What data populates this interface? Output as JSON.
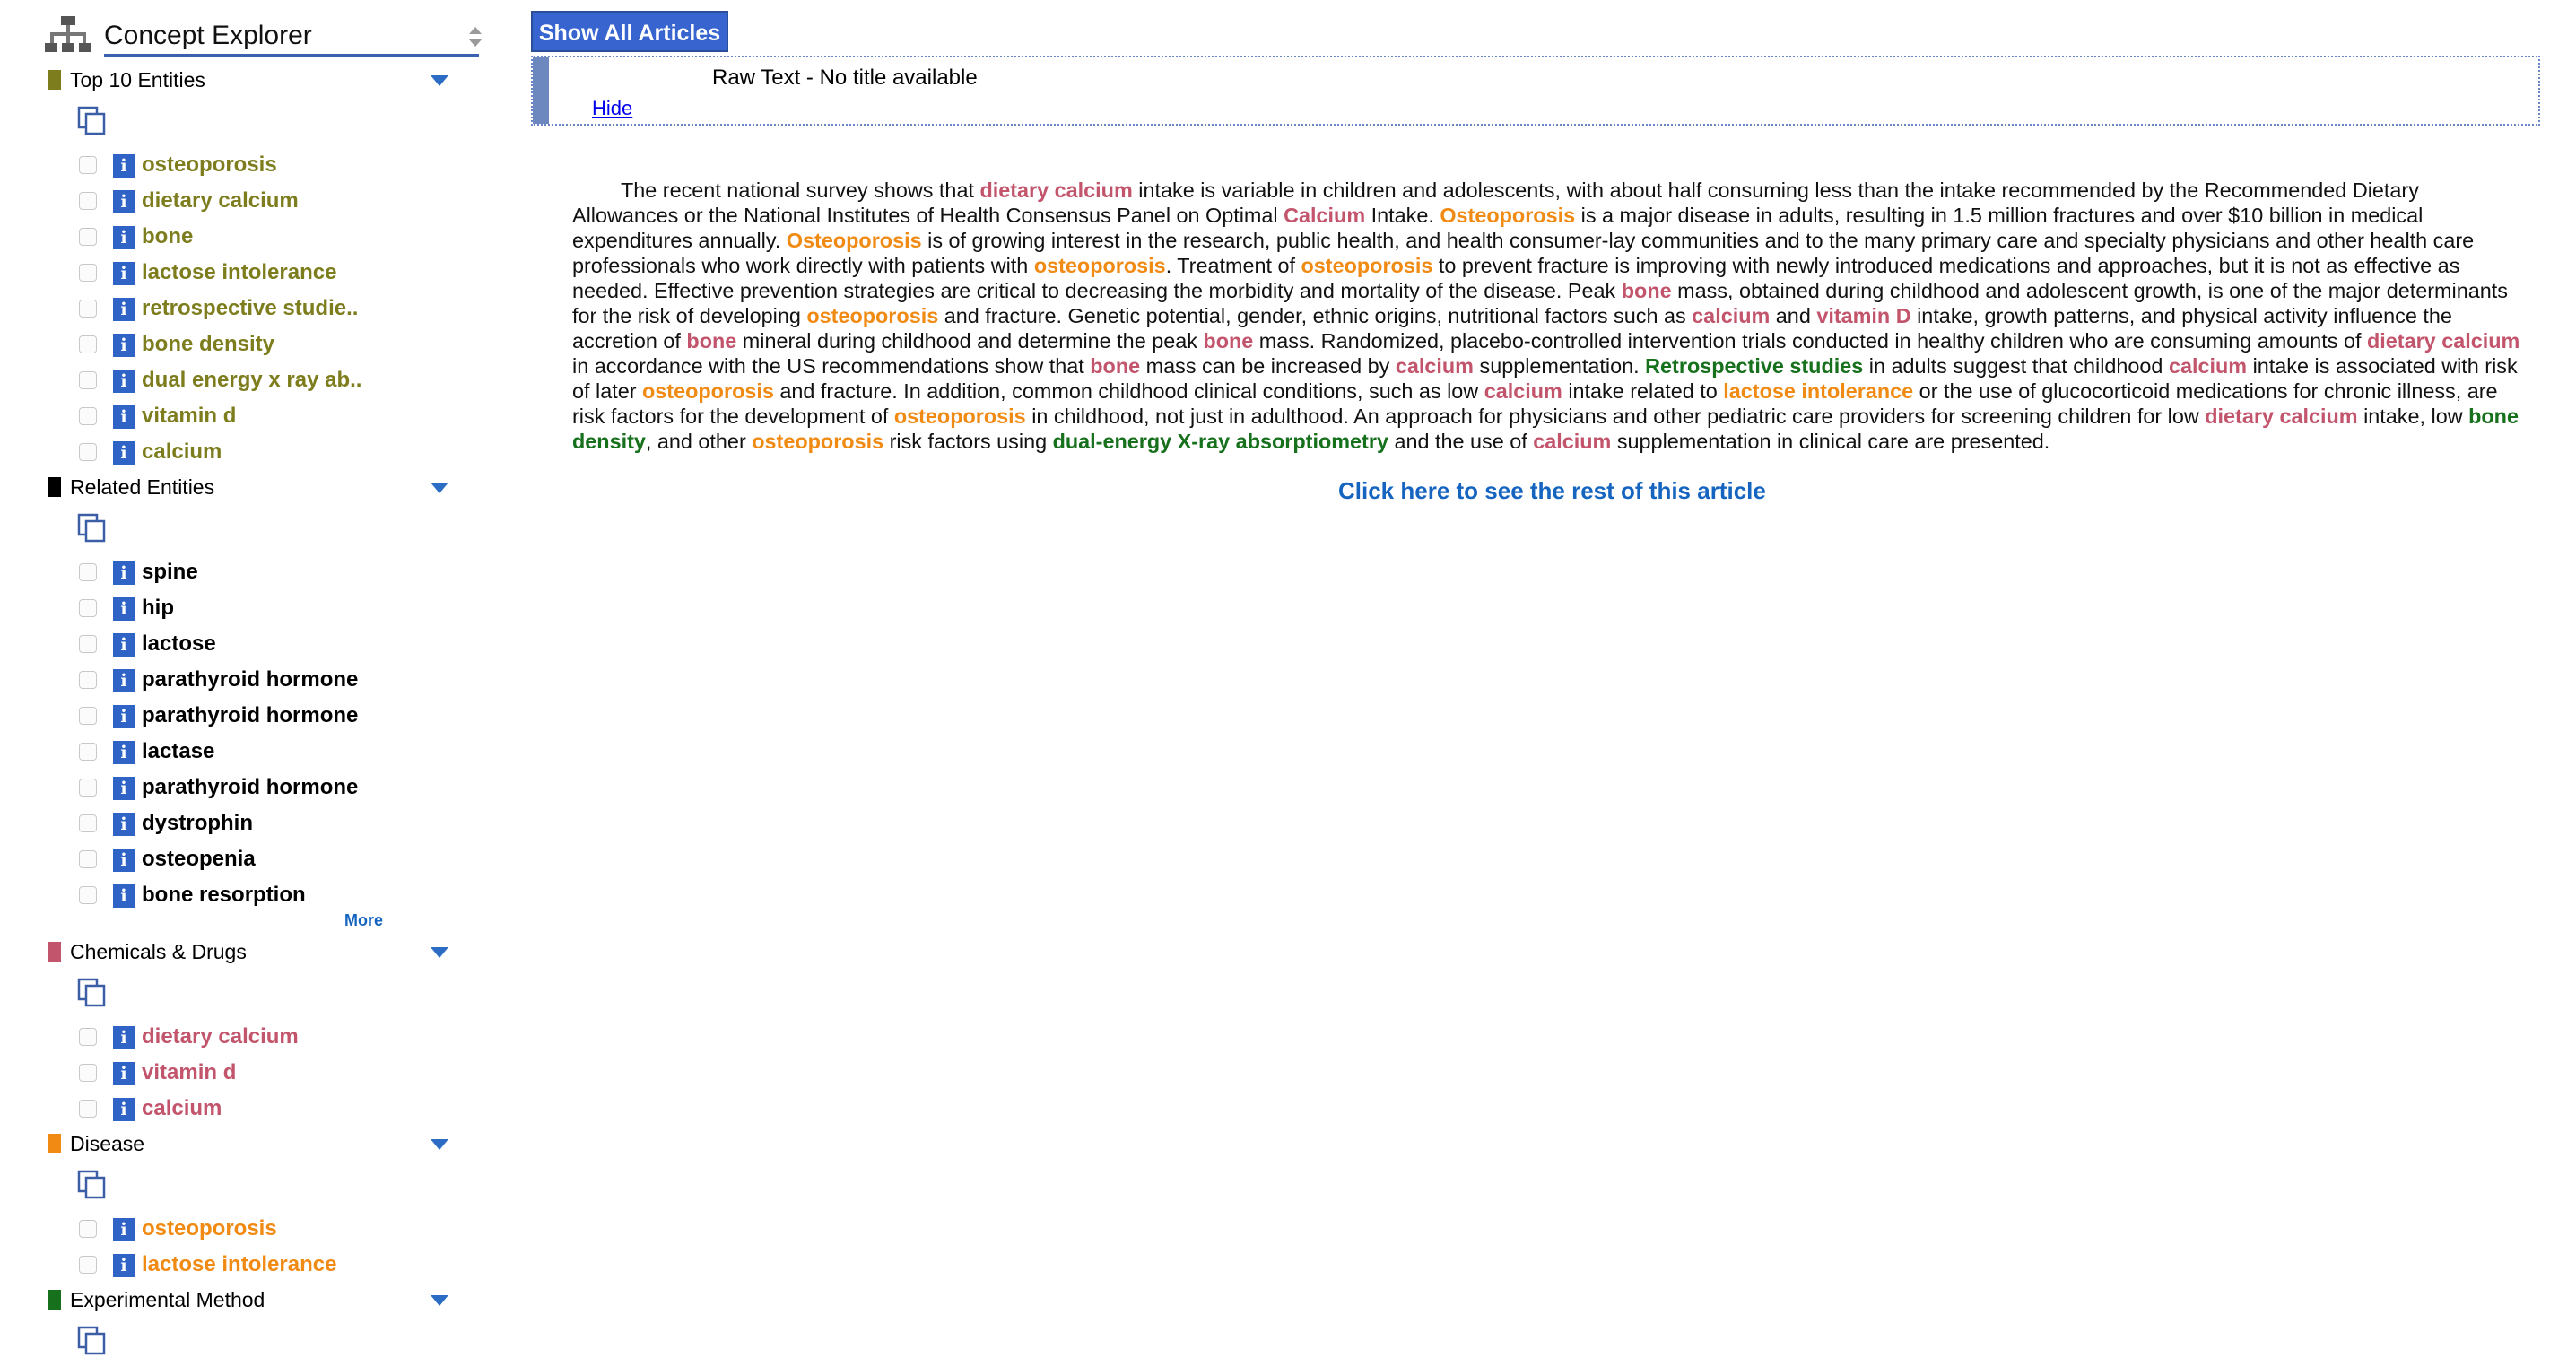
{
  "sidebar": {
    "title": "Concept Explorer",
    "sections": [
      {
        "title": "Top 10 Entities",
        "color": "#7d7d1e",
        "items": [
          "osteoporosis",
          "dietary calcium",
          "bone",
          "lactose intolerance",
          "retrospective studie..",
          "bone density",
          "dual energy x ray ab..",
          "vitamin d",
          "calcium"
        ]
      },
      {
        "title": "Related Entities",
        "color": "#000000",
        "items": [
          "spine",
          "hip",
          "lactose",
          "parathyroid hormone",
          "parathyroid hormone",
          "lactase",
          "parathyroid hormone",
          "dystrophin",
          "osteopenia",
          "bone resorption"
        ],
        "more_label": "More"
      },
      {
        "title": "Chemicals & Drugs",
        "color": "#c2546c",
        "items": [
          "dietary calcium",
          "vitamin d",
          "calcium"
        ]
      },
      {
        "title": "Disease",
        "color": "#f08a12",
        "items": [
          "osteoporosis",
          "lactose intolerance"
        ]
      },
      {
        "title": "Experimental Method",
        "color": "#16701c",
        "items": []
      }
    ],
    "info_glyph": "i"
  },
  "main": {
    "show_all_label": "Show All Articles",
    "article_title": "Raw Text - No title available",
    "hide_label": "Hide",
    "read_more_label": "Click here to see the rest of this article",
    "abstract": [
      [
        "t",
        "The recent national survey shows that "
      ],
      [
        "chem",
        "dietary calcium"
      ],
      [
        "t",
        " intake is variable in children and adolescents, with about half consuming less than the intake recommended by the Recommended Dietary Allowances or the National Institutes of Health Consensus Panel on Optimal "
      ],
      [
        "chem",
        "Calcium"
      ],
      [
        "t",
        " Intake. "
      ],
      [
        "dis",
        "Osteoporosis"
      ],
      [
        "t",
        " is a major disease in adults, resulting in 1.5 million fractures and over $10 billion in medical expenditures annually. "
      ],
      [
        "dis",
        "Osteoporosis"
      ],
      [
        "t",
        " is of growing interest in the research, public health, and health consumer-lay communities and to the many primary care and specialty physicians and other health care professionals who work directly with patients with "
      ],
      [
        "dis",
        "osteoporosis"
      ],
      [
        "t",
        ". Treatment of "
      ],
      [
        "dis",
        "osteoporosis"
      ],
      [
        "t",
        " to prevent fracture is improving with newly introduced medications and approaches, but it is not as effective as needed. Effective prevention strategies are critical to decreasing the morbidity and mortality of the disease. Peak "
      ],
      [
        "chem",
        "bone"
      ],
      [
        "t",
        " mass, obtained during childhood and adolescent growth, is one of the major determinants for the risk of developing "
      ],
      [
        "dis",
        "osteoporosis"
      ],
      [
        "t",
        " and fracture. Genetic potential, gender, ethnic origins, nutritional factors such as "
      ],
      [
        "chem",
        "calcium"
      ],
      [
        "t",
        " and "
      ],
      [
        "chem",
        "vitamin D"
      ],
      [
        "t",
        " intake, growth patterns, and physical activity influence the accretion of "
      ],
      [
        "chem",
        "bone"
      ],
      [
        "t",
        " mineral during childhood and determine the peak "
      ],
      [
        "chem",
        "bone"
      ],
      [
        "t",
        " mass. Randomized, placebo-controlled intervention trials conducted in healthy children who are consuming amounts of "
      ],
      [
        "chem",
        "dietary calcium"
      ],
      [
        "t",
        " in accordance with the US recommendations show that "
      ],
      [
        "chem",
        "bone"
      ],
      [
        "t",
        " mass can be increased by "
      ],
      [
        "chem",
        "calcium"
      ],
      [
        "t",
        " supplementation. "
      ],
      [
        "exp",
        "Retrospective studies"
      ],
      [
        "t",
        " in adults suggest that childhood "
      ],
      [
        "chem",
        "calcium"
      ],
      [
        "t",
        " intake is associated with risk of later "
      ],
      [
        "dis",
        "osteoporosis"
      ],
      [
        "t",
        " and fracture. In addition, common childhood clinical conditions, such as low "
      ],
      [
        "chem",
        "calcium"
      ],
      [
        "t",
        " intake related to "
      ],
      [
        "dis",
        "lactose intolerance"
      ],
      [
        "t",
        " or the use of glucocorticoid medications for chronic illness, are risk factors for the development of "
      ],
      [
        "dis",
        "osteoporosis"
      ],
      [
        "t",
        " in childhood, not just in adulthood. An approach for physicians and other pediatric care providers for screening children for low "
      ],
      [
        "chem",
        "dietary calcium"
      ],
      [
        "t",
        " intake, low "
      ],
      [
        "exp",
        "bone density"
      ],
      [
        "t",
        ", and other "
      ],
      [
        "dis",
        "osteoporosis"
      ],
      [
        "t",
        " risk factors using "
      ],
      [
        "exp",
        "dual-energy X-ray absorptiometry"
      ],
      [
        "t",
        " and the use of "
      ],
      [
        "chem",
        "calcium"
      ],
      [
        "t",
        " supplementation in clinical care are presented."
      ]
    ]
  }
}
